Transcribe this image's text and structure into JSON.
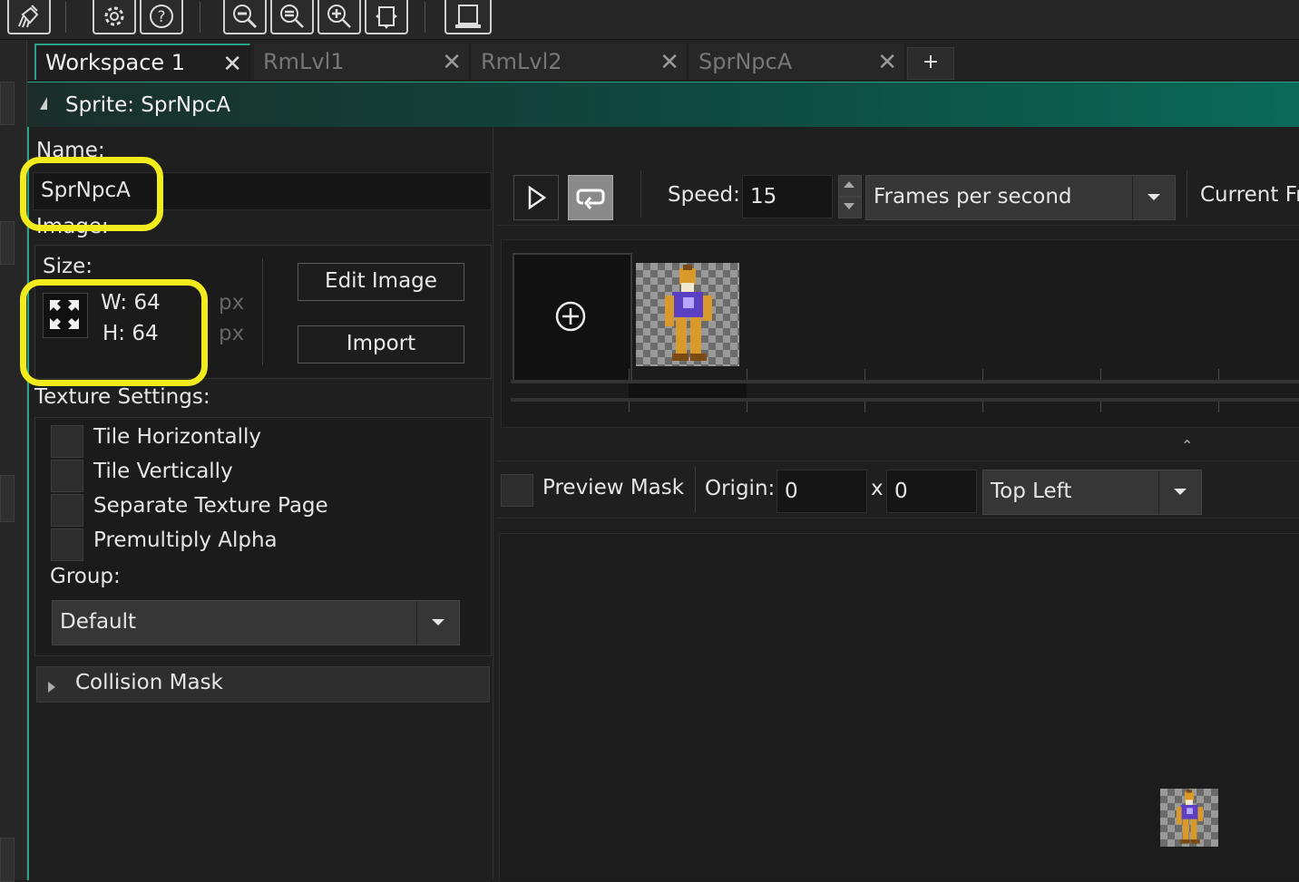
{
  "toolbar": {
    "buttons": [
      {
        "name": "clean-icon"
      },
      {
        "name": "settings-icon"
      },
      {
        "name": "help-icon"
      },
      {
        "name": "zoom-out-icon"
      },
      {
        "name": "zoom-reset-icon"
      },
      {
        "name": "zoom-in-icon"
      },
      {
        "name": "fit-screen-icon"
      },
      {
        "name": "device-icon"
      }
    ]
  },
  "tabs": [
    {
      "label": "Workspace 1",
      "active": true
    },
    {
      "label": "RmLvl1",
      "active": false
    },
    {
      "label": "RmLvl2",
      "active": false
    },
    {
      "label": "SprNpcA",
      "active": false
    }
  ],
  "tab_add_label": "+",
  "tab_close_glyph": "✕",
  "editor": {
    "title": "Sprite: SprNpcA"
  },
  "left_panel": {
    "name_label": "Name:",
    "name_value": "SprNpcA",
    "image_label": "Image:",
    "size_label": "Size:",
    "width_text": "W: 64",
    "height_text": "H: 64",
    "unit_w": "px",
    "unit_h": "px",
    "edit_image_label": "Edit Image",
    "import_label": "Import",
    "texture_settings_label": "Texture Settings:",
    "checkboxes": [
      {
        "label": "Tile Horizontally",
        "checked": false
      },
      {
        "label": "Tile Vertically",
        "checked": false
      },
      {
        "label": "Separate Texture Page",
        "checked": false
      },
      {
        "label": "Premultiply Alpha",
        "checked": false
      }
    ],
    "group_label": "Group:",
    "group_value": "Default",
    "collision_mask_label": "Collision Mask"
  },
  "right_panel": {
    "speed_label": "Speed:",
    "speed_value": "15",
    "speed_unit": "Frames per second",
    "current_frame_label": "Current Fr",
    "preview_mask_label": "Preview Mask",
    "origin_label": "Origin:",
    "origin_x": "0",
    "origin_sep": "x",
    "origin_y": "0",
    "origin_preset": "Top Left",
    "expand_glyph": "⌃"
  },
  "colors": {
    "accent": "#2aa387",
    "highlight": "#f2ec1f",
    "background": "#1f1f1f"
  }
}
